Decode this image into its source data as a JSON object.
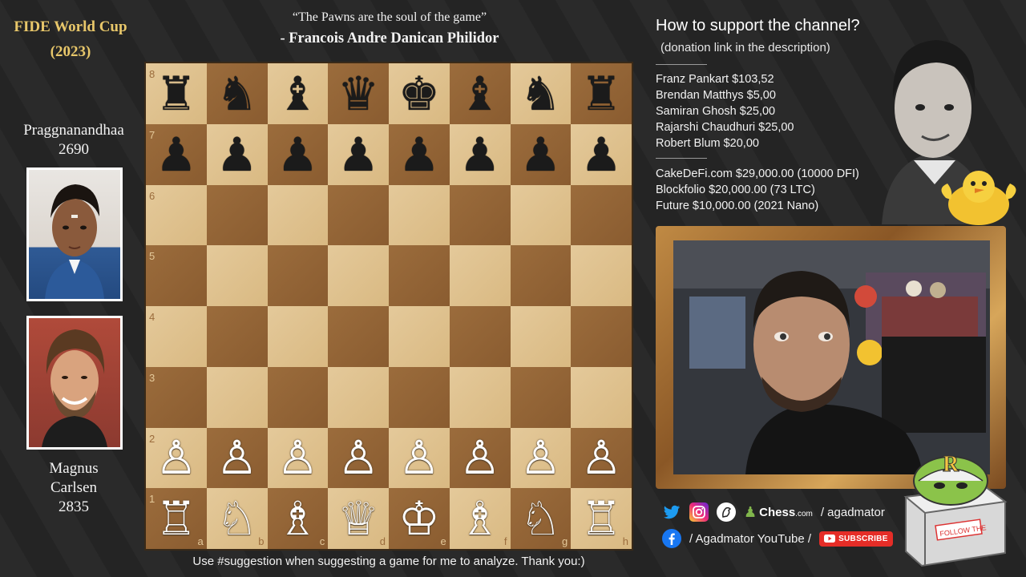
{
  "event": {
    "title": "FIDE World Cup",
    "year": "(2023)"
  },
  "players": {
    "top": {
      "name": "Praggnanandhaa",
      "rating": "2690"
    },
    "bottom": {
      "name_line1": "Magnus",
      "name_line2": "Carlsen",
      "rating": "2835"
    }
  },
  "quote": {
    "text": "“The Pawns are the soul of the game”",
    "author": "- Francois Andre Danican Philidor"
  },
  "board": {
    "ranks": [
      "8",
      "7",
      "6",
      "5",
      "4",
      "3",
      "2",
      "1"
    ],
    "files": [
      "a",
      "b",
      "c",
      "d",
      "e",
      "f",
      "g",
      "h"
    ],
    "position": [
      [
        "♜",
        "♞",
        "♝",
        "♛",
        "♚",
        "♝",
        "♞",
        "♜"
      ],
      [
        "♟",
        "♟",
        "♟",
        "♟",
        "♟",
        "♟",
        "♟",
        "♟"
      ],
      [
        "",
        "",
        "",
        "",
        "",
        "",
        "",
        ""
      ],
      [
        "",
        "",
        "",
        "",
        "",
        "",
        "",
        ""
      ],
      [
        "",
        "",
        "",
        "",
        "",
        "",
        "",
        ""
      ],
      [
        "",
        "",
        "",
        "",
        "",
        "",
        "",
        ""
      ],
      [
        "♙",
        "♙",
        "♙",
        "♙",
        "♙",
        "♙",
        "♙",
        "♙"
      ],
      [
        "♖",
        "♘",
        "♗",
        "♕",
        "♔",
        "♗",
        "♘",
        "♖"
      ]
    ],
    "colors": {
      "light": "#e4c99a",
      "dark": "#9b6c3c"
    }
  },
  "footer": {
    "text": "Use #suggestion when suggesting a game for me to analyze. Thank you:)"
  },
  "support": {
    "title": "How to support the channel?",
    "subtitle": "(donation link in the description)",
    "donors": [
      "Franz Pankart $103,52",
      "Brendan Matthys $5,00",
      "Samiran Ghosh $25,00",
      "Rajarshi Chaudhuri $25,00",
      "Robert Blum $20,00"
    ],
    "crypto": [
      "CakeDeFi.com $29,000.00 (10000 DFI)",
      "Blockfolio $20,000.00 (73 LTC)",
      "Future $10,000.00 (2021 Nano)"
    ]
  },
  "social": {
    "chess_brand": "Chess",
    "chess_suffix": ".com",
    "handle": "/ agadmator",
    "youtube_text": "/ Agadmator YouTube /",
    "subscribe_label": "SUBSCRIBE",
    "icons": [
      "twitter-icon",
      "instagram-icon",
      "lichess-icon",
      "chesscom-icon",
      "facebook-icon",
      "youtube-icon"
    ]
  },
  "mascot": {
    "letter": "R",
    "sign": "FOLLOW THE"
  }
}
